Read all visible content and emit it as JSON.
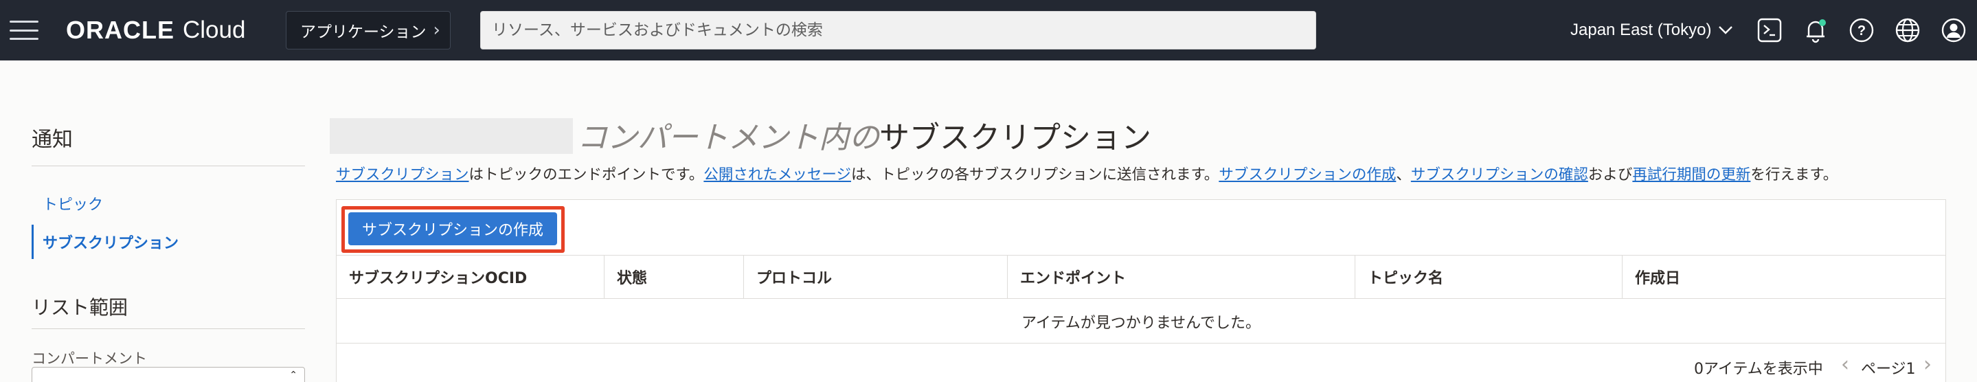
{
  "header": {
    "brand": "ORACLE",
    "product": "Cloud",
    "apps_label": "アプリケーション",
    "search_placeholder": "リソース、サービスおよびドキュメントの検索",
    "region": "Japan East (Tokyo)",
    "icons": [
      "menu-icon",
      "chevron-right-icon",
      "chevron-down-icon",
      "cloud-shell-icon",
      "bell-icon",
      "help-icon",
      "globe-icon",
      "user-icon"
    ],
    "notification_dot_color": "#3fd3a4"
  },
  "sidebar": {
    "title": "通知",
    "items": [
      {
        "label": "トピック",
        "active": false
      },
      {
        "label": "サブスクリプション",
        "active": true
      }
    ],
    "scope_title": "リスト範囲",
    "compartment_label": "コンパートメント"
  },
  "main": {
    "title_italic": "コンパートメント内の",
    "title_plain": "サブスクリプション",
    "description": {
      "link1": "サブスクリプション",
      "text1": "はトピックのエンドポイントです。",
      "link2": "公開されたメッセージ",
      "text2": "は、トピックの各サブスクリプションに送信されます。",
      "link3": "サブスクリプションの作成",
      "text3": "、",
      "link4": "サブスクリプションの確認",
      "text4": "および",
      "link5": "再試行期間の更新",
      "text5": "を行えます。"
    },
    "create_button": "サブスクリプションの作成",
    "columns": [
      "サブスクリプションOCID",
      "状態",
      "プロトコル",
      "エンドポイント",
      "トピック名",
      "作成日"
    ],
    "empty_message": "アイテムが見つかりませんでした。",
    "item_count": "0アイテムを表示中",
    "page_label": "ページ1"
  },
  "colors": {
    "header_bg": "#232832",
    "link": "#1b6ac9",
    "primary_button": "#2f77d1",
    "highlight_border": "#e64126"
  }
}
